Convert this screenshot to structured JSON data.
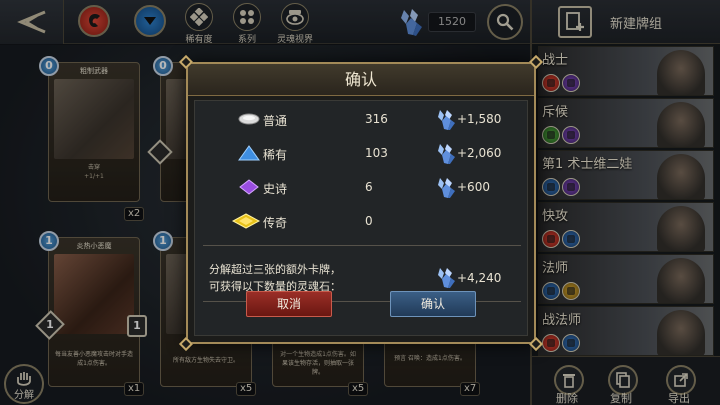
{
  "topbar": {
    "back_icon": "chevron-left-icon",
    "filters": [
      {
        "icon": "warrior-faction-icon",
        "color": "#c0392b"
      },
      {
        "icon": "dropdown-icon",
        "color": "#1f6fb4"
      }
    ],
    "filter_items": [
      {
        "label": "稀有度",
        "icon": "diamond-grid-icon"
      },
      {
        "label": "系列",
        "icon": "series-icon"
      },
      {
        "label": "灵魂视界",
        "icon": "eye-icon"
      }
    ],
    "shard_count": "1520",
    "search_icon": "search-icon"
  },
  "cards": [
    {
      "cost": "0",
      "name": "粗制武器",
      "text": "击穿",
      "stat": "+1/+1",
      "qty": "x2"
    },
    {
      "cost": "0",
      "name": "",
      "text": "",
      "stat": "",
      "qty": ""
    },
    {
      "cost": "1",
      "name": "炎热小恶魔",
      "text": "每当友善小恶魔攻击时对手造成1点伤害。",
      "stat": "",
      "qty": "x1",
      "atk": "1",
      "hp": "1"
    },
    {
      "cost": "1",
      "name": "",
      "text": "所有敌方生物失去守卫。",
      "stat": "",
      "qty": "x5"
    },
    {
      "cost": "",
      "name": "",
      "text": "对一个生物造成1点伤害。如果该生物存活，则抽取一张牌。",
      "stat": "",
      "qty": "x5"
    },
    {
      "cost": "",
      "name": "",
      "text": "预言 召唤：造成1点伤害。",
      "stat": "",
      "qty": "x7"
    }
  ],
  "decompose_label": "分解",
  "deck_panel": {
    "new_deck_label": "新建牌组",
    "decks": [
      {
        "name": "战士",
        "factions": [
          "red",
          "purple"
        ]
      },
      {
        "name": "斥候",
        "factions": [
          "green",
          "purple"
        ]
      },
      {
        "name": "第1 术士维二娃",
        "factions": [
          "blue",
          "purple"
        ]
      },
      {
        "name": "快攻",
        "factions": [
          "red",
          "blue"
        ]
      },
      {
        "name": "法师",
        "factions": [
          "blue",
          "yellow"
        ]
      },
      {
        "name": "战法师",
        "factions": [
          "red",
          "blue"
        ]
      }
    ],
    "footer": [
      {
        "label": "删除",
        "icon": "trash-icon"
      },
      {
        "label": "复制",
        "icon": "copy-icon"
      },
      {
        "label": "导出",
        "icon": "export-icon"
      }
    ]
  },
  "modal": {
    "title": "确认",
    "rows": [
      {
        "rarity": "普通",
        "count": "316",
        "shards": "+1,580",
        "icon": "common-rarity-icon",
        "color": "#d8d8d8"
      },
      {
        "rarity": "稀有",
        "count": "103",
        "shards": "+2,060",
        "icon": "rare-rarity-icon",
        "color": "#3d8ee0"
      },
      {
        "rarity": "史诗",
        "count": "6",
        "shards": "+600",
        "icon": "epic-rarity-icon",
        "color": "#9b4fe0"
      },
      {
        "rarity": "传奇",
        "count": "0",
        "shards": "",
        "icon": "legendary-rarity-icon",
        "color": "#e8c21a"
      }
    ],
    "summary_line1": "分解超过三张的额外卡牌，",
    "summary_line2": "可获得以下数量的灵魂石：",
    "summary_value": "+4,240",
    "cancel_label": "取消",
    "confirm_label": "确认"
  }
}
